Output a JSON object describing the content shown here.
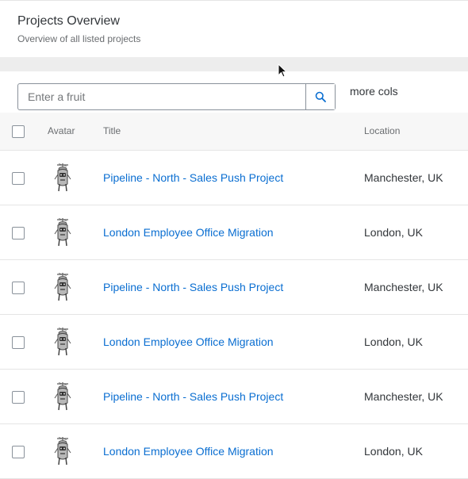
{
  "header": {
    "title": "Projects Overview",
    "subtitle": "Overview of all listed projects"
  },
  "toolbar": {
    "search_placeholder": "Enter a fruit",
    "search_icon": "search-icon",
    "more_cols_label": "more cols"
  },
  "table": {
    "columns": [
      "Avatar",
      "Title",
      "Location"
    ],
    "rows": [
      {
        "title": "Pipeline - North - Sales Push Project",
        "location": "Manchester, UK",
        "avatar_icon": "robot-avatar-icon"
      },
      {
        "title": "London Employee Office Migration",
        "location": "London, UK",
        "avatar_icon": "robot-avatar-icon"
      },
      {
        "title": "Pipeline - North - Sales Push Project",
        "location": "Manchester, UK",
        "avatar_icon": "robot-avatar-icon"
      },
      {
        "title": "London Employee Office Migration",
        "location": "London, UK",
        "avatar_icon": "robot-avatar-icon"
      },
      {
        "title": "Pipeline - North - Sales Push Project",
        "location": "Manchester, UK",
        "avatar_icon": "robot-avatar-icon"
      },
      {
        "title": "London Employee Office Migration",
        "location": "London, UK",
        "avatar_icon": "robot-avatar-icon"
      }
    ]
  },
  "colors": {
    "link": "#0a6ed1",
    "text": "#32363a",
    "muted": "#6a6d70",
    "header_band": "#ededed",
    "table_header_bg": "#f7f7f7",
    "border": "#89919a"
  }
}
